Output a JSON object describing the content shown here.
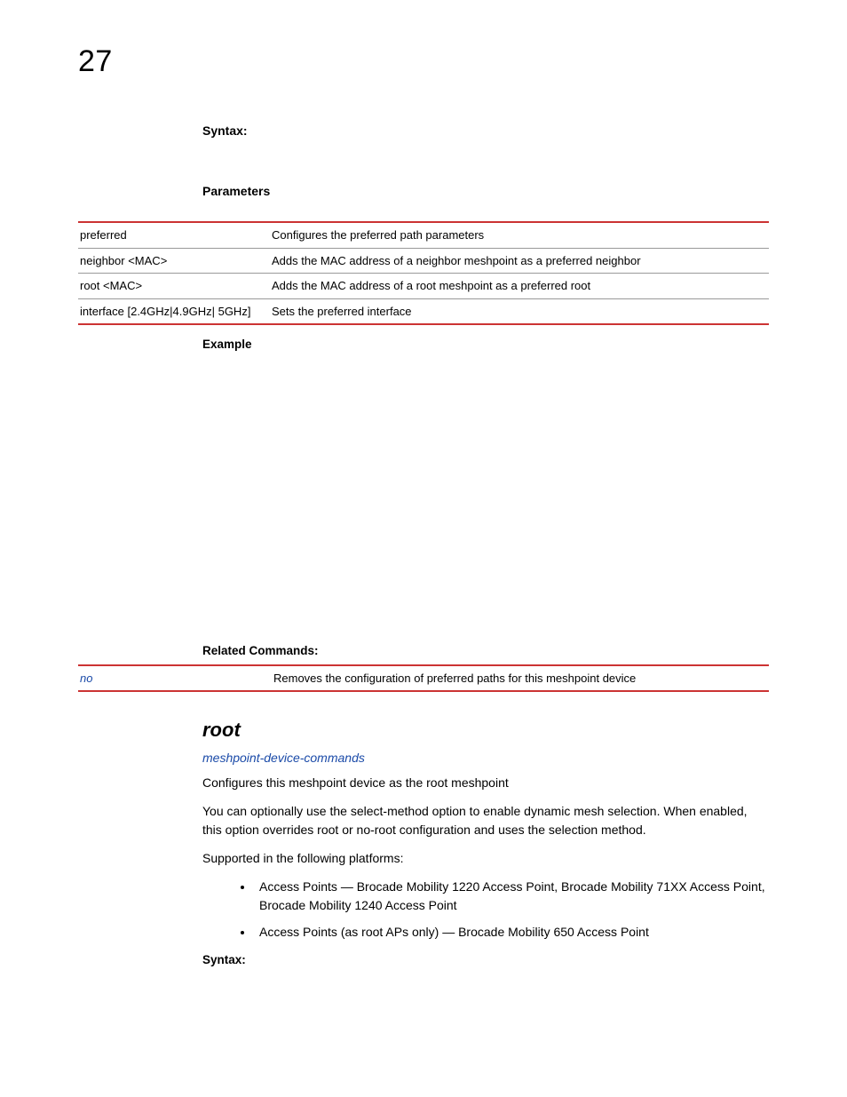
{
  "chapter": "27",
  "syntax_label": "Syntax:",
  "parameters_label": "Parameters",
  "params_rows": [
    {
      "p": "preferred",
      "d": "Configures the preferred path parameters"
    },
    {
      "p": "neighbor <MAC>",
      "d": "Adds the MAC address of a neighbor meshpoint as a preferred neighbor"
    },
    {
      "p": "root <MAC>",
      "d": "Adds the MAC address of a root meshpoint as a preferred root"
    },
    {
      "p": "interface [2.4GHz|4.9GHz| 5GHz]",
      "d": "Sets the preferred interface"
    }
  ],
  "example_label": "Example",
  "related_label": "Related Commands:",
  "related_row": {
    "cmd": "no",
    "desc": "Removes the configuration of preferred paths for this meshpoint device"
  },
  "section": {
    "title": "root",
    "link": "meshpoint-device-commands",
    "p1": "Configures this meshpoint device as the root meshpoint",
    "p2": "You can optionally use the select-method option to enable dynamic mesh selection. When enabled, this option overrides root or no-root configuration and uses the selection method.",
    "p3": "Supported in the following platforms:",
    "bullets": [
      "Access Points — Brocade Mobility 1220 Access Point, Brocade Mobility 71XX Access Point, Brocade Mobility 1240 Access Point",
      "Access Points (as root APs only) — Brocade Mobility 650 Access Point"
    ],
    "syntax_label": "Syntax:"
  }
}
